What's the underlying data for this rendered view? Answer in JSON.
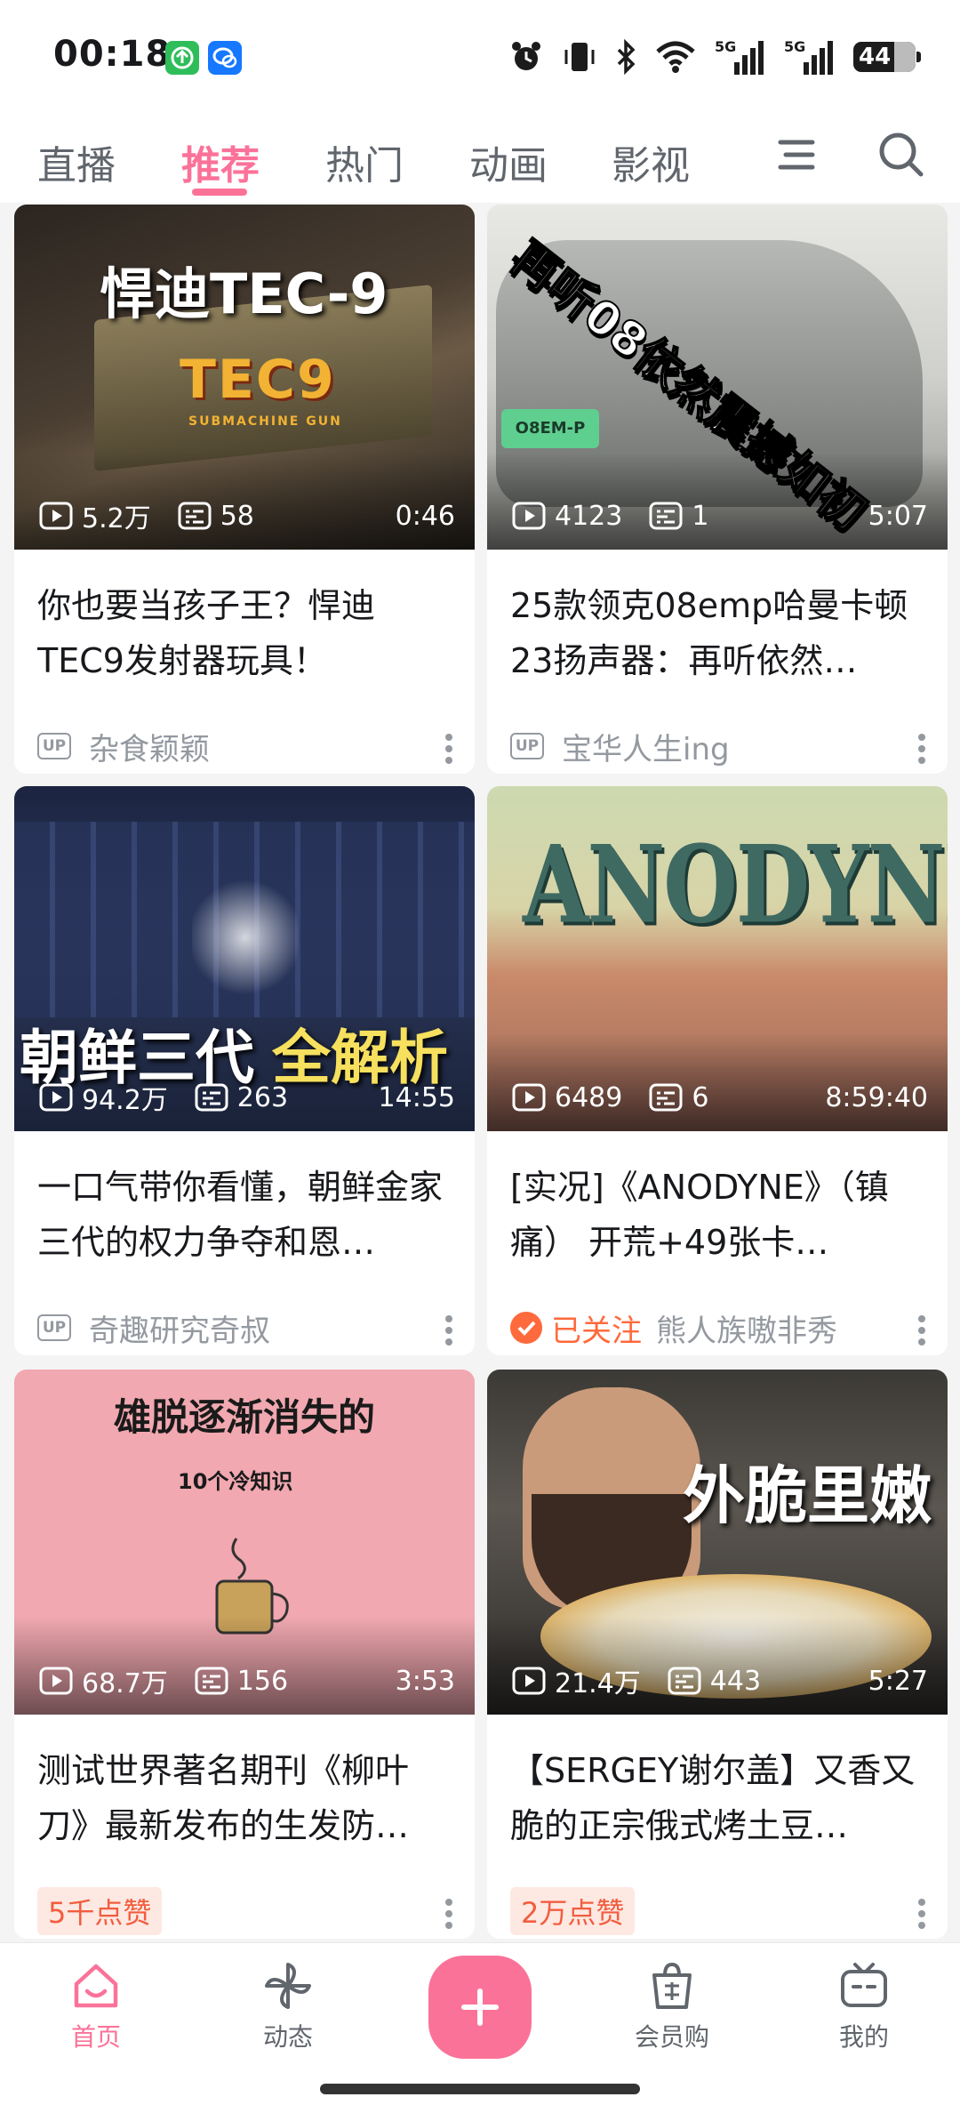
{
  "status_bar": {
    "time": "00:18",
    "battery": "44"
  },
  "top_nav": {
    "tabs": [
      {
        "label": "直播"
      },
      {
        "label": "推荐"
      },
      {
        "label": "热门"
      },
      {
        "label": "动画"
      },
      {
        "label": "影视"
      }
    ],
    "active_tab": "推荐",
    "accent": "#fb7299"
  },
  "feed": [
    {
      "thumb_text": "悍迪TEC-9",
      "thumb_text_2": "TEC9",
      "thumb_text_3": "SUBMACHINE GUN",
      "plays": "5.2万",
      "danmaku": "58",
      "duration": "0:46",
      "title": "你也要当孩子王？悍迪TEC9发射器玩具！",
      "badge": "UP",
      "author": "杂食颖颖"
    },
    {
      "thumb_text": "再听08依然震撼如初",
      "thumb_text_2": "O8EM-P",
      "plays": "4123",
      "danmaku": "1",
      "duration": "5:07",
      "title": "25款领克08emp哈曼卡顿23扬声器：再听依然…",
      "badge": "UP",
      "author": "宝华人生ing"
    },
    {
      "thumb_text": "朝鲜三代",
      "thumb_text_2": "全解析",
      "plays": "94.2万",
      "danmaku": "263",
      "duration": "14:55",
      "title": "一口气带你看懂，朝鲜金家三代的权力争夺和恩…",
      "badge": "UP",
      "author": "奇趣研究奇叔"
    },
    {
      "thumb_text": "ANODYNE",
      "plays": "6489",
      "danmaku": "6",
      "duration": "8:59:40",
      "title": "[实况]《ANODYNE》（镇痛） 开荒+49张卡…",
      "followed": "已关注",
      "author": "熊人族嗷非秀"
    },
    {
      "thumb_text": "雄脱逐渐消失的",
      "thumb_text_2": "10个冷知识",
      "plays": "68.7万",
      "danmaku": "156",
      "duration": "3:53",
      "title": "测试世界著名期刊《柳叶刀》最新发布的生发防…",
      "likes": "5千点赞"
    },
    {
      "thumb_text": "外脆里嫩",
      "plays": "21.4万",
      "danmaku": "443",
      "duration": "5:27",
      "title": "【SERGEY谢尔盖】又香又脆的正宗俄式烤土豆…",
      "likes": "2万点赞"
    }
  ],
  "bottom_nav": {
    "items": [
      {
        "label": "首页"
      },
      {
        "label": "动态"
      },
      {
        "label": "会员购"
      },
      {
        "label": "我的"
      }
    ],
    "active": "首页"
  }
}
